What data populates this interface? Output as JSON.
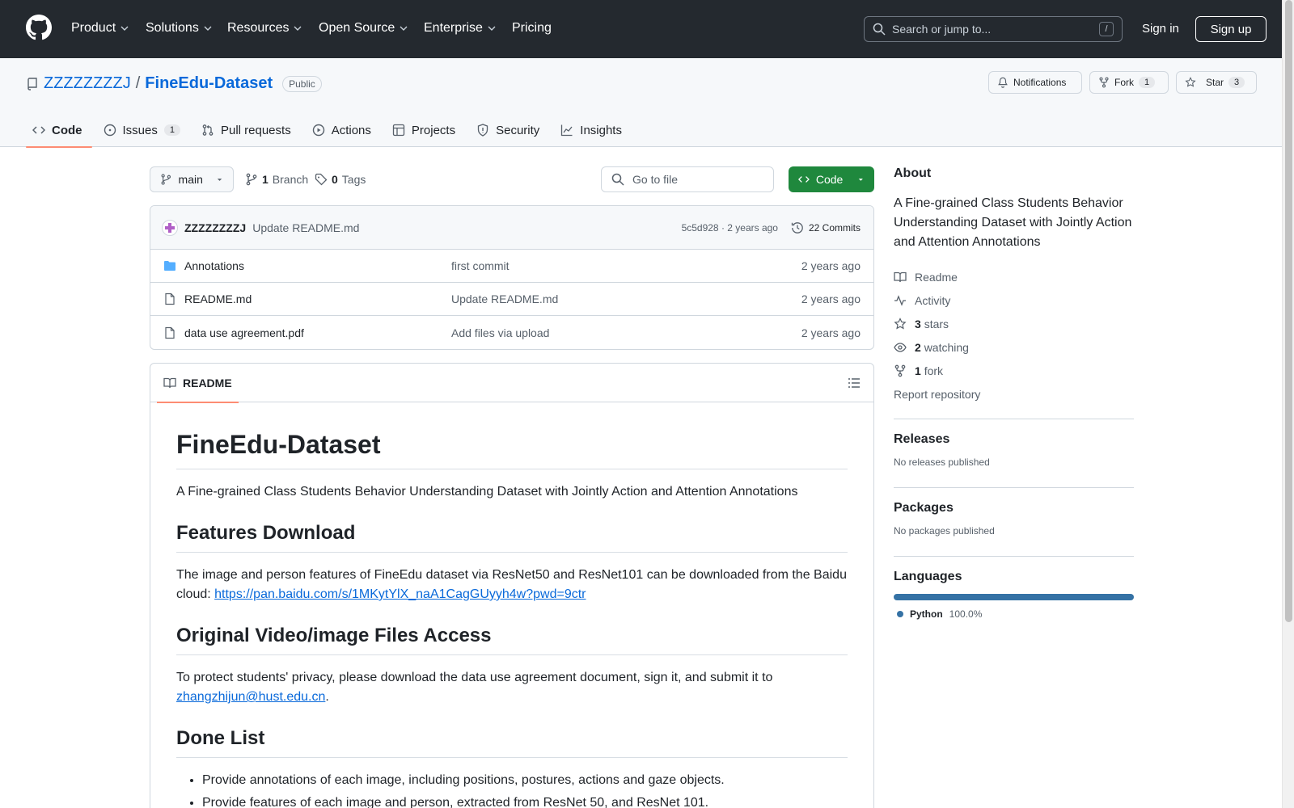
{
  "header": {
    "nav": [
      {
        "label": "Product",
        "dropdown": true
      },
      {
        "label": "Solutions",
        "dropdown": true
      },
      {
        "label": "Resources",
        "dropdown": true
      },
      {
        "label": "Open Source",
        "dropdown": true
      },
      {
        "label": "Enterprise",
        "dropdown": true
      },
      {
        "label": "Pricing",
        "dropdown": false
      }
    ],
    "search_placeholder": "Search or jump to...",
    "search_shortcut": "/",
    "sign_in": "Sign in",
    "sign_up": "Sign up"
  },
  "repo": {
    "owner": "ZZZZZZZZJ",
    "separator": "/",
    "name": "FineEdu-Dataset",
    "visibility": "Public",
    "notifications_label": "Notifications",
    "fork_label": "Fork",
    "fork_count": "1",
    "star_label": "Star",
    "star_count": "3"
  },
  "tabs": [
    {
      "label": "Code",
      "icon": "code-icon",
      "active": true
    },
    {
      "label": "Issues",
      "icon": "issue-icon",
      "count": "1"
    },
    {
      "label": "Pull requests",
      "icon": "pull-request-icon"
    },
    {
      "label": "Actions",
      "icon": "play-icon"
    },
    {
      "label": "Projects",
      "icon": "table-icon"
    },
    {
      "label": "Security",
      "icon": "shield-icon"
    },
    {
      "label": "Insights",
      "icon": "graph-icon"
    }
  ],
  "toolbar": {
    "branch": "main",
    "branch_count": "1",
    "branch_label": "Branch",
    "tag_count": "0",
    "tag_label": "Tags",
    "goto_placeholder": "Go to file",
    "code_button": "Code"
  },
  "latest_commit": {
    "author": "ZZZZZZZZJ",
    "message": "Update README.md",
    "meta": "5c5d928 · 2 years ago",
    "commits_label": "22 Commits"
  },
  "files": [
    {
      "name": "Annotations",
      "type": "folder",
      "commit": "first commit",
      "age": "2 years ago"
    },
    {
      "name": "README.md",
      "type": "file",
      "commit": "Update README.md",
      "age": "2 years ago"
    },
    {
      "name": "data use agreement.pdf",
      "type": "file",
      "commit": "Add files via upload",
      "age": "2 years ago"
    }
  ],
  "readme": {
    "tab_label": "README",
    "title": "FineEdu-Dataset",
    "intro": "A Fine-grained Class Students Behavior Understanding Dataset with Jointly Action and Attention Annotations",
    "h_features": "Features Download",
    "features_text": "The image and person features of FineEdu dataset via ResNet50 and ResNet101 can be downloaded from the Baidu cloud: ",
    "features_link": "https://pan.baidu.com/s/1MKytYlX_naA1CagGUyyh4w?pwd=9ctr",
    "h_access": "Original Video/image Files Access",
    "access_text": "To protect students' privacy, please download the data use agreement document, sign it, and submit it to ",
    "access_email": "zhangzhijun@hust.edu.cn",
    "access_end": ".",
    "h_done": "Done List",
    "done_items": [
      "Provide annotations of each image, including positions, postures, actions and gaze objects.",
      "Provide features of each image and person, extracted from ResNet 50, and ResNet 101."
    ]
  },
  "about": {
    "title": "About",
    "description": "A Fine-grained Class Students Behavior Understanding Dataset with Jointly Action and Attention Annotations",
    "readme": "Readme",
    "activity": "Activity",
    "stars_count": "3",
    "stars_label": "stars",
    "watching_count": "2",
    "watching_label": "watching",
    "fork_count": "1",
    "fork_label": "fork",
    "report": "Report repository"
  },
  "releases": {
    "title": "Releases",
    "note": "No releases published"
  },
  "packages": {
    "title": "Packages",
    "note": "No packages published"
  },
  "languages": {
    "title": "Languages",
    "items": [
      {
        "name": "Python",
        "percent": "100.0%",
        "color": "#3572a5"
      }
    ]
  },
  "colors": {
    "accent": "#0969da",
    "header_bg": "#24292f",
    "primary_button": "#1f883d",
    "tab_underline": "#fd8c73"
  }
}
